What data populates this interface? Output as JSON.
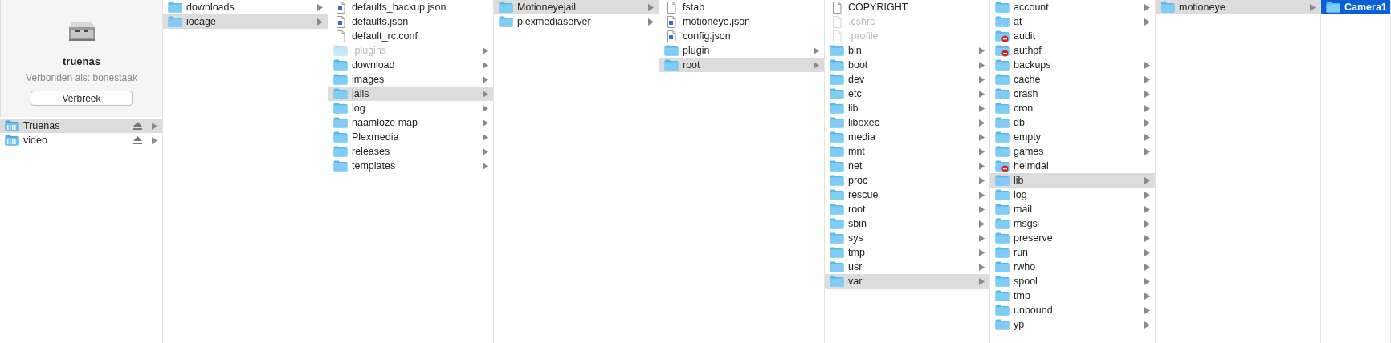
{
  "device": {
    "name": "truenas",
    "status": "Verbonden als: bonestaak",
    "button": "Verbreek"
  },
  "volumes": [
    {
      "name": "Truenas",
      "selected": true
    },
    {
      "name": "video",
      "selected": false
    }
  ],
  "columns": [
    {
      "focused": false,
      "items": [
        {
          "name": "downloads",
          "kind": "folder",
          "selected": false,
          "has_children": true,
          "hidden": false
        },
        {
          "name": "iocage",
          "kind": "folder",
          "selected": true,
          "has_children": true,
          "hidden": false
        }
      ]
    },
    {
      "focused": false,
      "items": [
        {
          "name": "defaults_backup.json",
          "kind": "json",
          "selected": false,
          "has_children": false,
          "hidden": false
        },
        {
          "name": "defaults.json",
          "kind": "json",
          "selected": false,
          "has_children": false,
          "hidden": false
        },
        {
          "name": "default_rc.conf",
          "kind": "file",
          "selected": false,
          "has_children": false,
          "hidden": false
        },
        {
          "name": ".plugins",
          "kind": "folder",
          "selected": false,
          "has_children": true,
          "hidden": true
        },
        {
          "name": "download",
          "kind": "folder",
          "selected": false,
          "has_children": true,
          "hidden": false
        },
        {
          "name": "images",
          "kind": "folder",
          "selected": false,
          "has_children": true,
          "hidden": false
        },
        {
          "name": "jails",
          "kind": "folder",
          "selected": true,
          "has_children": true,
          "hidden": false
        },
        {
          "name": "log",
          "kind": "folder",
          "selected": false,
          "has_children": true,
          "hidden": false
        },
        {
          "name": "naamloze map",
          "kind": "folder",
          "selected": false,
          "has_children": true,
          "hidden": false
        },
        {
          "name": "Plexmedia",
          "kind": "folder",
          "selected": false,
          "has_children": true,
          "hidden": false
        },
        {
          "name": "releases",
          "kind": "folder",
          "selected": false,
          "has_children": true,
          "hidden": false
        },
        {
          "name": "templates",
          "kind": "folder",
          "selected": false,
          "has_children": true,
          "hidden": false
        }
      ]
    },
    {
      "focused": false,
      "items": [
        {
          "name": "Motioneyejail",
          "kind": "folder",
          "selected": true,
          "has_children": true,
          "hidden": false
        },
        {
          "name": "plexmediaserver",
          "kind": "folder",
          "selected": false,
          "has_children": true,
          "hidden": false
        }
      ]
    },
    {
      "focused": false,
      "items": [
        {
          "name": "fstab",
          "kind": "file",
          "selected": false,
          "has_children": false,
          "hidden": false
        },
        {
          "name": "motioneye.json",
          "kind": "json",
          "selected": false,
          "has_children": false,
          "hidden": false
        },
        {
          "name": "config.json",
          "kind": "json",
          "selected": false,
          "has_children": false,
          "hidden": false
        },
        {
          "name": "plugin",
          "kind": "folder",
          "selected": false,
          "has_children": true,
          "hidden": false
        },
        {
          "name": "root",
          "kind": "folder",
          "selected": true,
          "has_children": true,
          "hidden": false
        }
      ]
    },
    {
      "focused": false,
      "items": [
        {
          "name": "COPYRIGHT",
          "kind": "file",
          "selected": false,
          "has_children": false,
          "hidden": false
        },
        {
          "name": ".cshrc",
          "kind": "file",
          "selected": false,
          "has_children": false,
          "hidden": true
        },
        {
          "name": ".profile",
          "kind": "file",
          "selected": false,
          "has_children": false,
          "hidden": true
        },
        {
          "name": "bin",
          "kind": "folder",
          "selected": false,
          "has_children": true,
          "hidden": false
        },
        {
          "name": "boot",
          "kind": "folder",
          "selected": false,
          "has_children": true,
          "hidden": false
        },
        {
          "name": "dev",
          "kind": "folder",
          "selected": false,
          "has_children": true,
          "hidden": false
        },
        {
          "name": "etc",
          "kind": "folder",
          "selected": false,
          "has_children": true,
          "hidden": false
        },
        {
          "name": "lib",
          "kind": "folder",
          "selected": false,
          "has_children": true,
          "hidden": false
        },
        {
          "name": "libexec",
          "kind": "folder",
          "selected": false,
          "has_children": true,
          "hidden": false
        },
        {
          "name": "media",
          "kind": "folder",
          "selected": false,
          "has_children": true,
          "hidden": false
        },
        {
          "name": "mnt",
          "kind": "folder",
          "selected": false,
          "has_children": true,
          "hidden": false
        },
        {
          "name": "net",
          "kind": "folder",
          "selected": false,
          "has_children": true,
          "hidden": false
        },
        {
          "name": "proc",
          "kind": "folder",
          "selected": false,
          "has_children": true,
          "hidden": false
        },
        {
          "name": "rescue",
          "kind": "folder",
          "selected": false,
          "has_children": true,
          "hidden": false
        },
        {
          "name": "root",
          "kind": "folder",
          "selected": false,
          "has_children": true,
          "hidden": false
        },
        {
          "name": "sbin",
          "kind": "folder",
          "selected": false,
          "has_children": true,
          "hidden": false
        },
        {
          "name": "sys",
          "kind": "folder",
          "selected": false,
          "has_children": true,
          "hidden": false
        },
        {
          "name": "tmp",
          "kind": "folder",
          "selected": false,
          "has_children": true,
          "hidden": false
        },
        {
          "name": "usr",
          "kind": "folder",
          "selected": false,
          "has_children": true,
          "hidden": false
        },
        {
          "name": "var",
          "kind": "folder",
          "selected": true,
          "has_children": true,
          "hidden": false
        }
      ]
    },
    {
      "focused": false,
      "items": [
        {
          "name": "account",
          "kind": "folder",
          "selected": false,
          "has_children": true,
          "hidden": false
        },
        {
          "name": "at",
          "kind": "folder",
          "selected": false,
          "has_children": true,
          "hidden": false
        },
        {
          "name": "audit",
          "kind": "restricted",
          "selected": false,
          "has_children": false,
          "hidden": false
        },
        {
          "name": "authpf",
          "kind": "restricted",
          "selected": false,
          "has_children": false,
          "hidden": false
        },
        {
          "name": "backups",
          "kind": "folder",
          "selected": false,
          "has_children": true,
          "hidden": false
        },
        {
          "name": "cache",
          "kind": "folder",
          "selected": false,
          "has_children": true,
          "hidden": false
        },
        {
          "name": "crash",
          "kind": "folder",
          "selected": false,
          "has_children": true,
          "hidden": false
        },
        {
          "name": "cron",
          "kind": "folder",
          "selected": false,
          "has_children": true,
          "hidden": false
        },
        {
          "name": "db",
          "kind": "folder",
          "selected": false,
          "has_children": true,
          "hidden": false
        },
        {
          "name": "empty",
          "kind": "folder",
          "selected": false,
          "has_children": true,
          "hidden": false
        },
        {
          "name": "games",
          "kind": "folder",
          "selected": false,
          "has_children": true,
          "hidden": false
        },
        {
          "name": "heimdal",
          "kind": "restricted",
          "selected": false,
          "has_children": false,
          "hidden": false
        },
        {
          "name": "lib",
          "kind": "folder",
          "selected": true,
          "has_children": true,
          "hidden": false
        },
        {
          "name": "log",
          "kind": "folder",
          "selected": false,
          "has_children": true,
          "hidden": false
        },
        {
          "name": "mail",
          "kind": "folder",
          "selected": false,
          "has_children": true,
          "hidden": false
        },
        {
          "name": "msgs",
          "kind": "folder",
          "selected": false,
          "has_children": true,
          "hidden": false
        },
        {
          "name": "preserve",
          "kind": "folder",
          "selected": false,
          "has_children": true,
          "hidden": false
        },
        {
          "name": "run",
          "kind": "folder",
          "selected": false,
          "has_children": true,
          "hidden": false
        },
        {
          "name": "rwho",
          "kind": "folder",
          "selected": false,
          "has_children": true,
          "hidden": false
        },
        {
          "name": "spool",
          "kind": "folder",
          "selected": false,
          "has_children": true,
          "hidden": false
        },
        {
          "name": "tmp",
          "kind": "folder",
          "selected": false,
          "has_children": true,
          "hidden": false
        },
        {
          "name": "unbound",
          "kind": "folder",
          "selected": false,
          "has_children": true,
          "hidden": false
        },
        {
          "name": "yp",
          "kind": "folder",
          "selected": false,
          "has_children": true,
          "hidden": false
        }
      ]
    },
    {
      "focused": false,
      "items": [
        {
          "name": "motioneye",
          "kind": "folder",
          "selected": true,
          "has_children": true,
          "hidden": false
        }
      ]
    },
    {
      "focused": true,
      "items": [
        {
          "name": "Camera1",
          "kind": "folder",
          "selected": true,
          "hidden": false
        }
      ]
    }
  ]
}
